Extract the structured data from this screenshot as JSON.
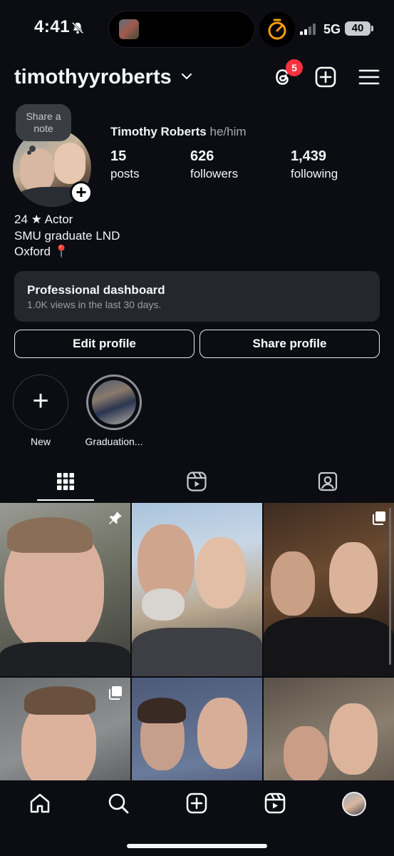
{
  "status_bar": {
    "time": "4:41",
    "network": "5G",
    "battery": "40"
  },
  "header": {
    "username": "timothyyroberts",
    "threads_badge": "5"
  },
  "profile": {
    "note": [
      "Share a",
      "note"
    ],
    "name": "Timothy Roberts",
    "pronouns": "he/him",
    "stats": [
      {
        "value": "15",
        "label": "posts"
      },
      {
        "value": "626",
        "label": "followers"
      },
      {
        "value": "1,439",
        "label": "following"
      }
    ],
    "bio": [
      "24 ★ Actor",
      "SMU graduate LND",
      "Oxford 📍"
    ]
  },
  "dashboard": {
    "title": "Professional dashboard",
    "subtitle": "1.0K views in the last 30 days."
  },
  "buttons": {
    "edit": "Edit profile",
    "share": "Share profile"
  },
  "highlights": [
    {
      "label": "New"
    },
    {
      "label": "Graduation..."
    }
  ],
  "tabs": [
    "grid-icon",
    "reels-icon",
    "tagged-icon"
  ],
  "nav": [
    "home-icon",
    "search-icon",
    "create-icon",
    "reels-icon",
    "profile-avatar"
  ],
  "colors": {
    "background": "#0b0d12",
    "badge": "#ff3040",
    "card": "#25272d"
  }
}
